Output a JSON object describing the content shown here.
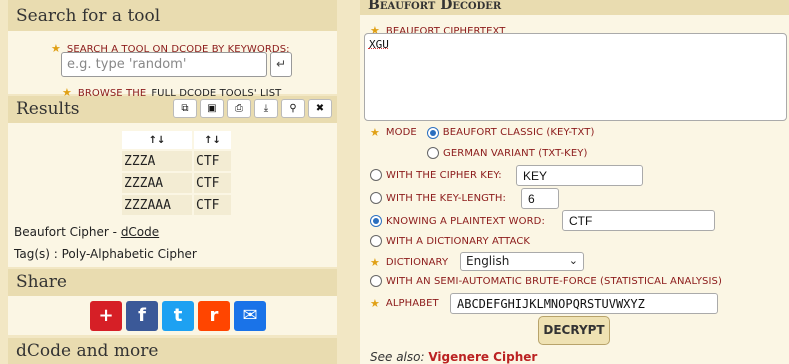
{
  "search": {
    "title": "Search for a tool",
    "keywords_label": "Search a tool on dCode by keywords:",
    "placeholder": "e.g. type 'random'",
    "enter_glyph": "↵",
    "browse_prefix": "Browse the",
    "browse_link": "full dCode tools' list"
  },
  "results": {
    "title": "Results",
    "tool_buttons": [
      "copy",
      "screenshot",
      "print",
      "download",
      "pin",
      "close"
    ],
    "tool_glyphs": [
      "⧉",
      "▣",
      "⎙",
      "⤓",
      "⚲",
      "✖"
    ],
    "col_headers": [
      "↑↓",
      "↑↓"
    ],
    "rows": [
      {
        "key": "ZZZA",
        "plain": "CTF"
      },
      {
        "key": "ZZZAA",
        "plain": "CTF"
      },
      {
        "key": "ZZZAAA",
        "plain": "CTF"
      }
    ],
    "credit_prefix": "Beaufort Cipher - ",
    "credit_link": "dCode",
    "tags": "Tag(s) : Poly-Alphabetic Cipher"
  },
  "share": {
    "title": "Share",
    "icons": [
      {
        "name": "addthis-icon",
        "glyph": "+",
        "color": "#d61f26"
      },
      {
        "name": "facebook-icon",
        "glyph": "f",
        "color": "#3b5998"
      },
      {
        "name": "twitter-icon",
        "glyph": "t",
        "color": "#1da1f2"
      },
      {
        "name": "reddit-icon",
        "glyph": "r",
        "color": "#ff4500"
      },
      {
        "name": "email-icon",
        "glyph": "✉",
        "color": "#1a73e8"
      }
    ]
  },
  "more": {
    "title": "dCode and more"
  },
  "decoder": {
    "title": "Beaufort Decoder",
    "ciphertext_label": "Beaufort ciphertext",
    "ciphertext_value": "XGU",
    "mode_label": "Mode",
    "mode_classic": "Beaufort classic (Key-Txt)",
    "mode_german": "German variant (Txt-Key)",
    "cipher_key_label": "With the cipher key:",
    "cipher_key_value": "KEY",
    "key_length_label": "With the key-length:",
    "key_length_value": "6",
    "plaintext_word_label": "Knowing a plaintext word:",
    "plaintext_word_value": "CTF",
    "dictionary_attack_label": "With a dictionary attack",
    "dictionary_label": "Dictionary",
    "dictionary_value": "English",
    "bruteforce_label": "With an semi-automatic brute-force (statistical analysis)",
    "alphabet_label": "Alphabet",
    "alphabet_value": "ABCDEFGHIJKLMNOPQRSTUVWXYZ",
    "decrypt_label": "DECRYPT",
    "see_also_prefix": "See also: ",
    "see_also_link": "Vigenere Cipher"
  },
  "colors": {
    "accent": "#8b1a1a",
    "radio": "#2a6fbf",
    "panel_head": "#e9dcb0"
  }
}
